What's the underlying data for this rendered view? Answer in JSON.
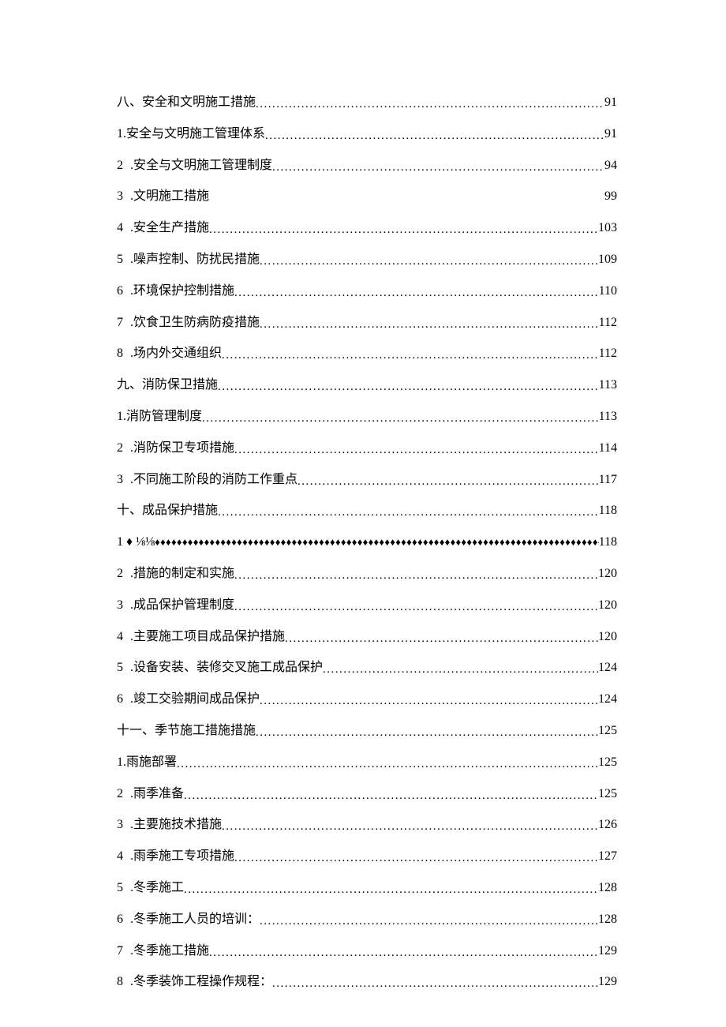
{
  "entries": [
    {
      "label": "八、安全和文明施工措施 ",
      "page": "91",
      "leader": "dots"
    },
    {
      "label": "1.安全与文明施工管理体系 ",
      "page": "91",
      "leader": "dots"
    },
    {
      "pre": "2",
      "label": ".安全与文明施工管理制度",
      "page": "94",
      "leader": "dots"
    },
    {
      "pre": "3",
      "label": ".文明施工措施",
      "page": "99",
      "leader": "none"
    },
    {
      "pre": "4",
      "label": ".安全生产措施 ",
      "page": "103",
      "leader": "dots"
    },
    {
      "pre": "5",
      "label": ".噪声控制、防扰民措施 ",
      "page": "109",
      "leader": "dots"
    },
    {
      "pre": "6",
      "label": ".环境保护控制措施 ",
      "page": "110",
      "leader": "dots"
    },
    {
      "pre": "7",
      "label": ".饮食卫生防病防疫措施 ",
      "page": "112",
      "leader": "dots"
    },
    {
      "pre": "8",
      "label": ".场内外交通组织 ",
      "page": "112",
      "leader": "dots"
    },
    {
      "label": "九、消防保卫措施",
      "page": "113",
      "leader": "dots"
    },
    {
      "label": "1.消防管理制度 ",
      "page": "113",
      "leader": "dots"
    },
    {
      "pre": "2",
      "label": ".消防保卫专项措施",
      "page": "114",
      "leader": "dots"
    },
    {
      "pre": "3",
      "label": ".不同施工阶段的消防工作重点 ",
      "page": "117",
      "leader": "dots"
    },
    {
      "label": "十、成品保护措施",
      "page": "118",
      "leader": "dots"
    },
    {
      "label": "1  ♦   ⅛⅛   ",
      "page": "118",
      "leader": "diamonds"
    },
    {
      "pre": "2",
      "label": ".措施的制定和实施 ",
      "page": "120",
      "leader": "dots"
    },
    {
      "pre": "3",
      "label": ".成品保护管理制度 ",
      "page": "120",
      "leader": "dots"
    },
    {
      "pre": "4",
      "label": ".主要施工项目成品保护措施 ",
      "page": "120",
      "leader": "dots"
    },
    {
      "pre": "5",
      "label": ".设备安装、装修交叉施工成品保护 ",
      "page": "124",
      "leader": "dots"
    },
    {
      "pre": "6",
      "label": ".竣工交验期间成品保护 ",
      "page": "124",
      "leader": "dots"
    },
    {
      "label": "十一、季节施工措施措施",
      "page": "125",
      "leader": "dots"
    },
    {
      "label": "1.雨施部署 ",
      "page": "125",
      "leader": "dots"
    },
    {
      "pre": "2",
      "label": ".雨季准备 ",
      "page": "125",
      "leader": "dots"
    },
    {
      "pre": "3",
      "label": ".主要施技术措施 ",
      "page": "126",
      "leader": "dots"
    },
    {
      "pre": "4",
      "label": ".雨季施工专项措施 ",
      "page": "127",
      "leader": "dots"
    },
    {
      "pre": "5",
      "label": ".冬季施工 ",
      "page": "128",
      "leader": "dots"
    },
    {
      "pre": "6",
      "label": ".冬季施工人员的培训： ",
      "page": "128",
      "leader": "dots"
    },
    {
      "pre": "7",
      "label": ".冬季施工措施 ",
      "page": "129",
      "leader": "dots"
    },
    {
      "pre": "8",
      "label": ".冬季装饰工程操作规程： ",
      "page": "129",
      "leader": "dots"
    }
  ]
}
